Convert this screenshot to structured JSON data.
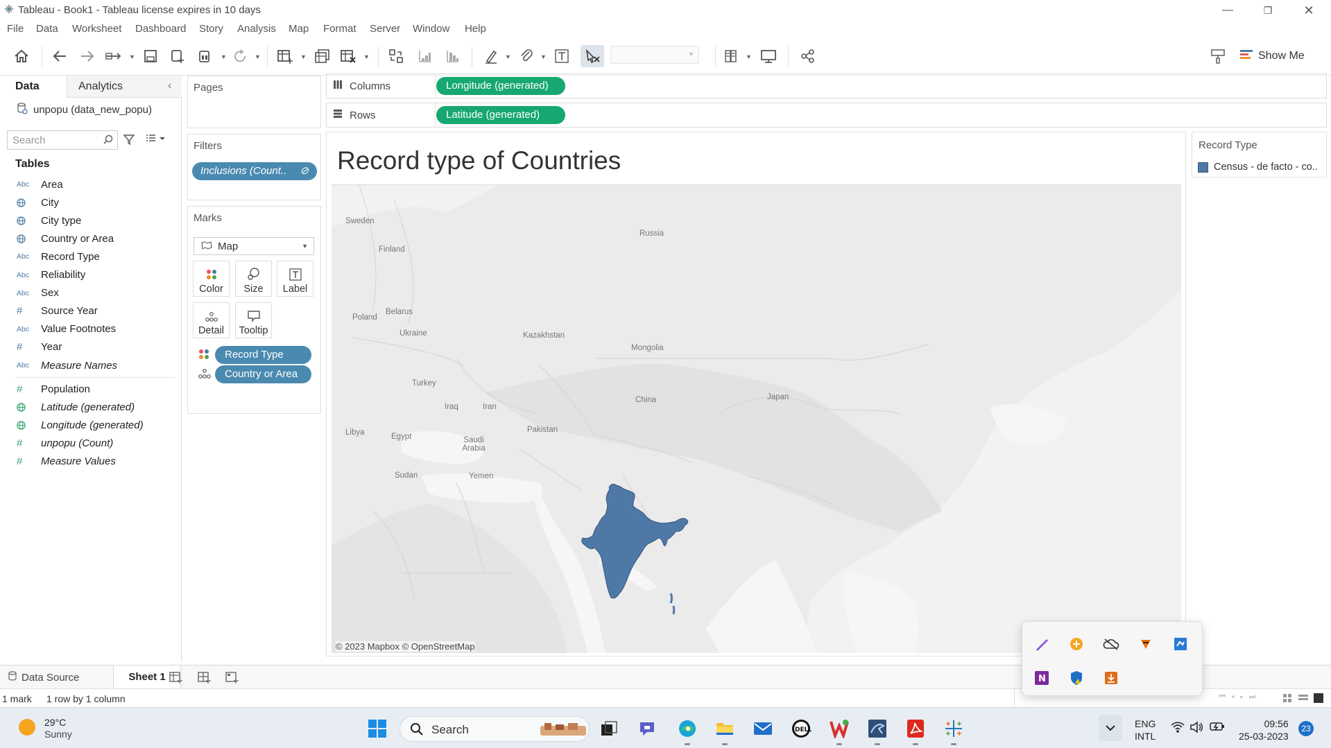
{
  "window": {
    "title": "Tableau - Book1 - Tableau license expires in 10 days",
    "controls": [
      "minimize",
      "restore",
      "close"
    ]
  },
  "menu": [
    "File",
    "Data",
    "Worksheet",
    "Dashboard",
    "Story",
    "Analysis",
    "Map",
    "Format",
    "Server",
    "Window",
    "Help"
  ],
  "toolbar": {
    "show_me_label": "Show Me",
    "fit_value": ""
  },
  "data_pane": {
    "tabs": {
      "data": "Data",
      "analytics": "Analytics"
    },
    "datasource": "unpopu (data_new_popu)",
    "search_placeholder": "Search",
    "tables_heading": "Tables",
    "dimensions": [
      {
        "type": "Abc",
        "label": "Area",
        "italic": false
      },
      {
        "type": "globe",
        "label": "City",
        "italic": false
      },
      {
        "type": "globe",
        "label": "City type",
        "italic": false
      },
      {
        "type": "globe",
        "label": "Country or Area",
        "italic": false
      },
      {
        "type": "Abc",
        "label": "Record Type",
        "italic": false
      },
      {
        "type": "Abc",
        "label": "Reliability",
        "italic": false
      },
      {
        "type": "Abc",
        "label": "Sex",
        "italic": false
      },
      {
        "type": "#",
        "label": "Source Year",
        "italic": false
      },
      {
        "type": "Abc",
        "label": "Value Footnotes",
        "italic": false
      },
      {
        "type": "#",
        "label": "Year",
        "italic": false
      },
      {
        "type": "Abc",
        "label": "Measure Names",
        "italic": true
      }
    ],
    "measures": [
      {
        "type": "#",
        "label": "Population",
        "italic": false
      },
      {
        "type": "globe",
        "label": "Latitude (generated)",
        "italic": true
      },
      {
        "type": "globe",
        "label": "Longitude (generated)",
        "italic": true
      },
      {
        "type": "#",
        "label": "unpopu (Count)",
        "italic": true
      },
      {
        "type": "#",
        "label": "Measure Values",
        "italic": true
      }
    ]
  },
  "cards": {
    "pages": "Pages",
    "filters": "Filters",
    "filter_pill": "Inclusions (Count..",
    "marks": "Marks",
    "mark_type": "Map",
    "mark_buttons": [
      "Color",
      "Size",
      "Label",
      "Detail",
      "Tooltip"
    ],
    "mark_pills": [
      "Record Type",
      "Country or Area"
    ]
  },
  "shelves": {
    "columns_label": "Columns",
    "columns_pill": "Longitude (generated)",
    "rows_label": "Rows",
    "rows_pill": "Latitude (generated)"
  },
  "viz": {
    "title": "Record type of Countries",
    "highlight_color": "#4e79a7",
    "map_labels": [
      {
        "name": "Sweden"
      },
      {
        "name": "Finland"
      },
      {
        "name": "Russia"
      },
      {
        "name": "Belarus"
      },
      {
        "name": "Poland"
      },
      {
        "name": "Ukraine"
      },
      {
        "name": "Kazakhstan"
      },
      {
        "name": "Mongolia"
      },
      {
        "name": "Turkey"
      },
      {
        "name": "Iraq"
      },
      {
        "name": "Iran"
      },
      {
        "name": "China"
      },
      {
        "name": "Japan"
      },
      {
        "name": "Pakistan"
      },
      {
        "name": "Libya"
      },
      {
        "name": "Egypt"
      },
      {
        "name": "Saudi Arabia"
      },
      {
        "name": "Sudan"
      },
      {
        "name": "Yemen"
      }
    ],
    "attribution": "© 2023 Mapbox © OpenStreetMap"
  },
  "legend": {
    "title": "Record Type",
    "items": [
      "Census - de facto - co.."
    ],
    "swatch_color": "#4e79a7"
  },
  "sheet_tabs": {
    "datasource": "Data Source",
    "sheet": "Sheet 1"
  },
  "status": {
    "marks": "1 mark",
    "dims": "1 row by 1 column"
  },
  "taskbar": {
    "weather_temp": "29°C",
    "weather_cond": "Sunny",
    "search_label": "Search",
    "lang_line1": "ENG",
    "lang_line2": "INTL",
    "time": "09:56",
    "date": "25-03-2023",
    "notifications": "23"
  }
}
